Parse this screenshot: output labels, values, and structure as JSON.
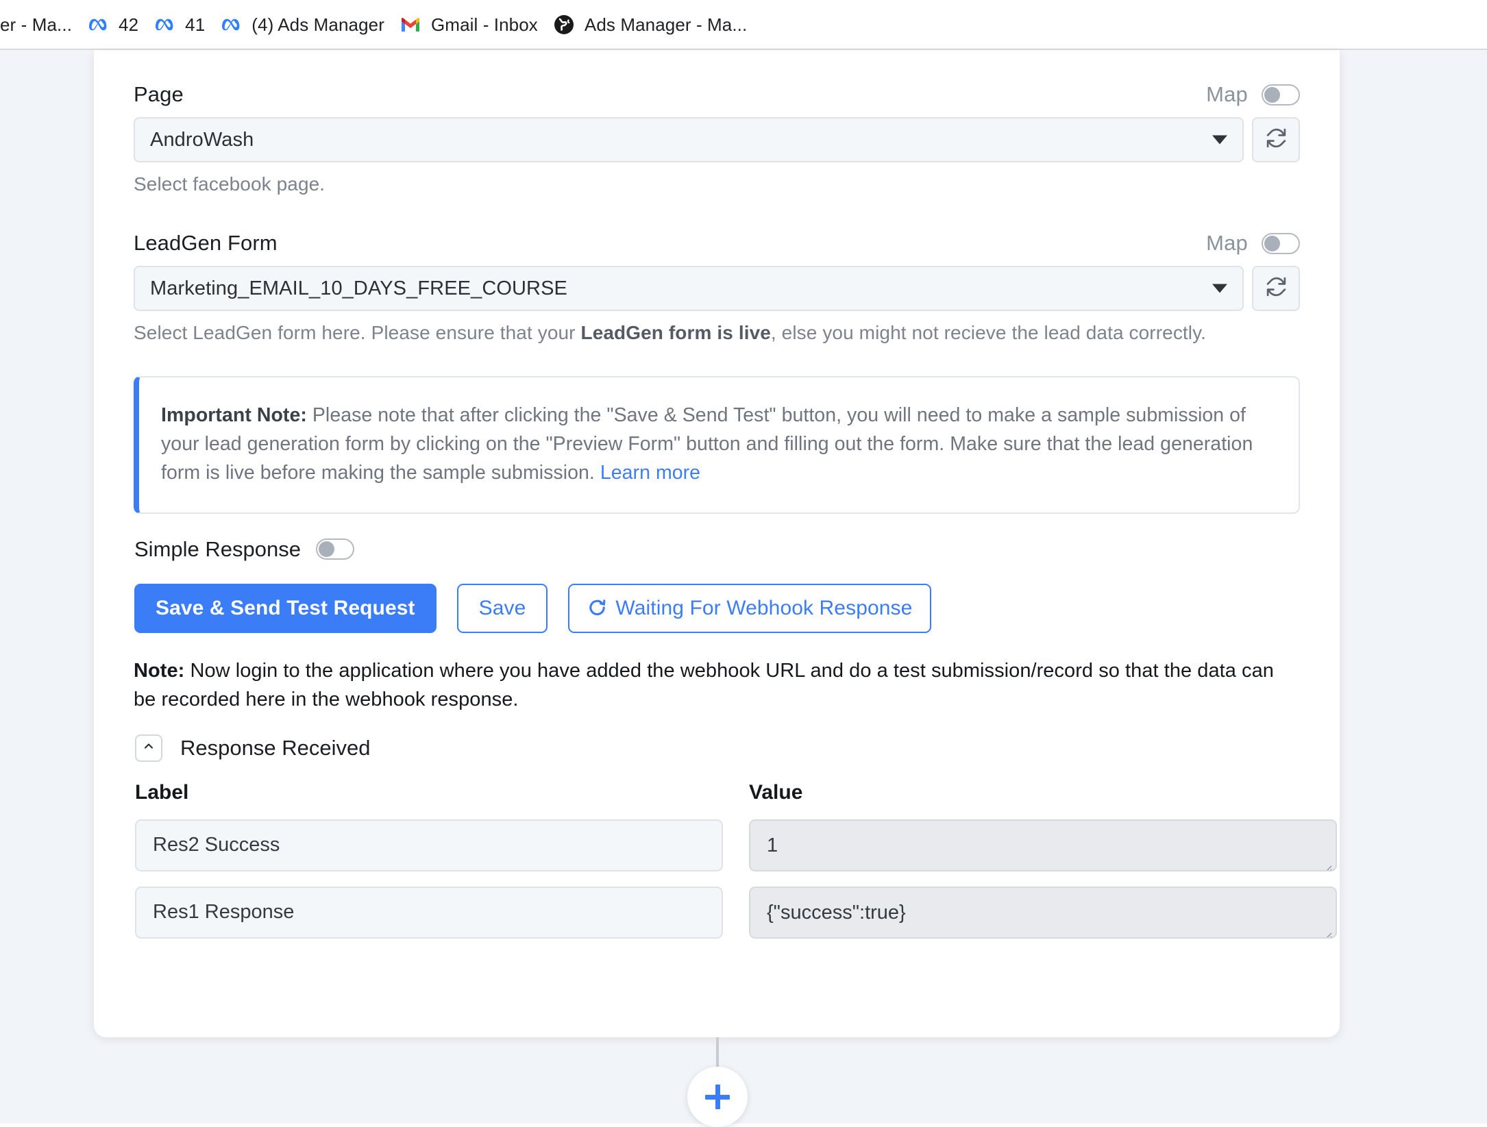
{
  "browser": {
    "tabs": [
      {
        "title": "er - Ma...",
        "icon": "none"
      },
      {
        "title": "42",
        "icon": "meta-icon"
      },
      {
        "title": "41",
        "icon": "meta-icon"
      },
      {
        "title": "(4) Ads Manager",
        "icon": "meta-icon"
      },
      {
        "title": "Gmail - Inbox",
        "icon": "gmail-icon"
      },
      {
        "title": "Ads Manager - Ma...",
        "icon": "globe-icon"
      }
    ]
  },
  "colors": {
    "accent_blue": "#3b7df6",
    "page_bg": "#f1f4f8",
    "card_bg": "#ffffff",
    "input_bg": "#f3f7fa",
    "textarea_bg": "#e8eaee",
    "muted_text": "#7c838d"
  },
  "form": {
    "page_field": {
      "label": "Page",
      "map_label": "Map",
      "map_toggle_on": false,
      "value": "AndroWash",
      "help": "Select facebook page.",
      "refresh_icon": "refresh-icon",
      "caret_icon": "chevron-down-icon"
    },
    "leadgen_field": {
      "label": "LeadGen Form",
      "map_label": "Map",
      "map_toggle_on": false,
      "value": "Marketing_EMAIL_10_DAYS_FREE_COURSE",
      "help_pre": "Select LeadGen form here. Please ensure that your ",
      "help_bold": "LeadGen form is live",
      "help_post": ", else you might not recieve the lead data correctly.",
      "refresh_icon": "refresh-icon",
      "caret_icon": "chevron-down-icon"
    },
    "note_callout": {
      "strong": "Important Note:",
      "body": " Please note that after clicking the \"Save & Send Test\" button, you will need to make a sample submission of your lead generation form by clicking on the \"Preview Form\" button and filling out the form. Make sure that the lead generation form is live before making the sample submission. ",
      "link": "Learn more"
    },
    "simple_response": {
      "label": "Simple Response",
      "toggle_on": false
    },
    "buttons": {
      "save_and_send": "Save & Send Test Request",
      "save": "Save",
      "waiting": "Waiting For Webhook Response",
      "waiting_icon": "spinner-icon"
    },
    "bottom_note": {
      "strong": "Note:",
      "body": " Now login to the application where you have added the webhook URL and do a test submission/record so that the data can be recorded here in the webhook response."
    },
    "response_received": {
      "title": "Response Received",
      "collapse_icon": "chevron-up-icon",
      "columns": {
        "label": "Label",
        "value": "Value"
      },
      "rows": [
        {
          "label": "Res2 Success",
          "value": "1"
        },
        {
          "label": "Res1 Response",
          "value": "{\"success\":true}"
        }
      ]
    }
  },
  "flow": {
    "add_node_icon": "plus-icon"
  }
}
